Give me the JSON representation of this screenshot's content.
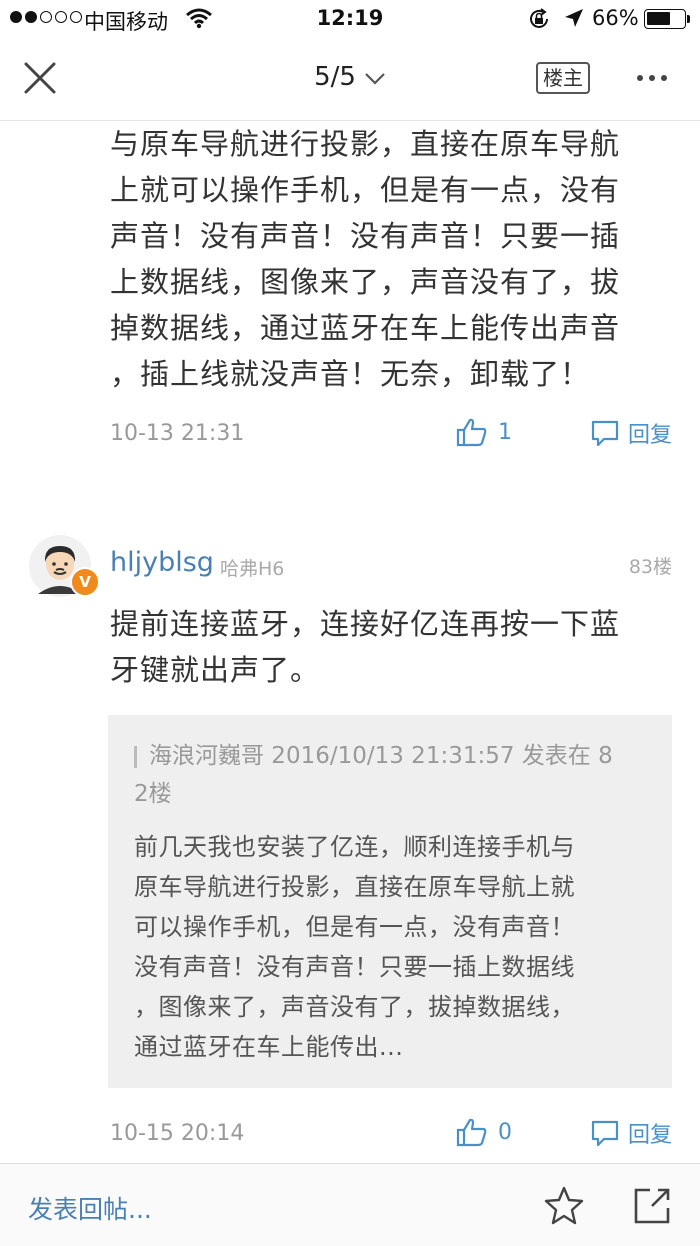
{
  "status_bar": {
    "carrier": "中国移动",
    "time": "12:19",
    "battery_pct": "66%",
    "battery_level": 0.66
  },
  "nav": {
    "page_indicator": "5/5",
    "owner_label": "楼主"
  },
  "post_prev": {
    "body_lines": [
      "与原车导航进行投影，直接在原车导航",
      "上就可以操作手机，但是有一点，没有",
      "声音！没有声音！没有声音！只要一插",
      "上数据线，图像来了，声音没有了，拔",
      "掉数据线，通过蓝牙在车上能传出声音",
      "，插上线就没声音！无奈，卸载了！"
    ],
    "time": "10-13 21:31",
    "likes": "1",
    "reply_label": "回复"
  },
  "post_83": {
    "username": "hljyblsg",
    "car_model": "哈弗H6",
    "floor": "83楼",
    "badge": "V",
    "body_lines": [
      "提前连接蓝牙，连接好亿连再按一下蓝",
      "牙键就出声了。"
    ],
    "quote": {
      "header_line1": "海浪河巍哥 2016/10/13 21:31:57 发表在 8",
      "header_line2": "2楼",
      "body_lines": [
        "前几天我也安装了亿连，顺利连接手机与",
        "原车导航进行投影，直接在原车导航上就",
        "可以操作手机，但是有一点，没有声音！",
        "没有声音！没有声音！只要一插上数据线",
        "，图像来了，声音没有了，拔掉数据线，",
        "通过蓝牙在车上能传出..."
      ]
    },
    "time": "10-15 20:14",
    "likes": "0",
    "reply_label": "回复"
  },
  "bottom_bar": {
    "post_reply_label": "发表回帖..."
  }
}
